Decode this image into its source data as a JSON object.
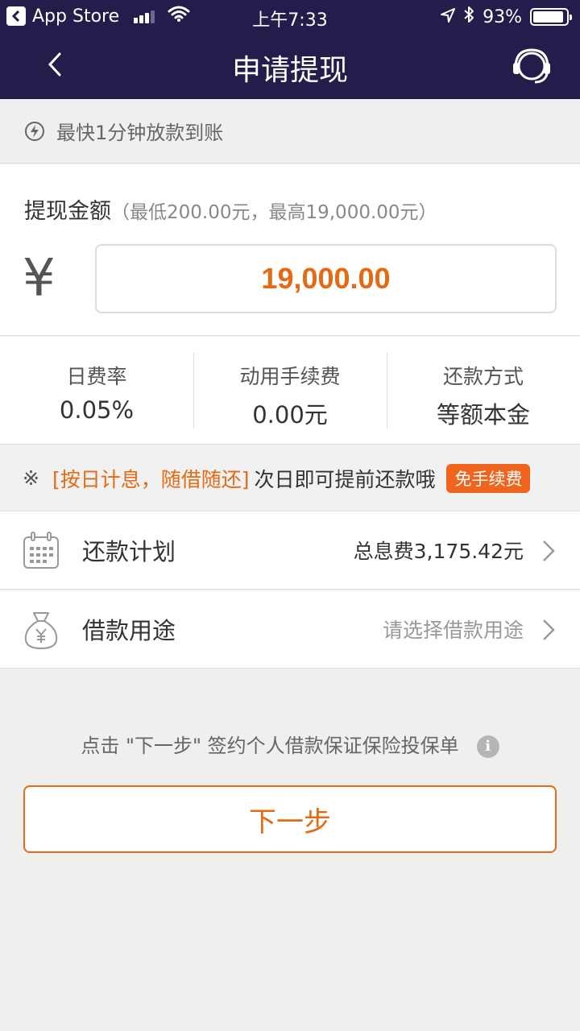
{
  "status_bar": {
    "back_app": "App Store",
    "time": "上午7:33",
    "battery": "93%",
    "battery_level": 0.93
  },
  "nav": {
    "title": "申请提现",
    "back_icon": "chevron-left-icon",
    "support_icon": "customer-service-headset-icon"
  },
  "notice": {
    "text": "最快1分钟放款到账",
    "icon": "lightning-icon"
  },
  "amount": {
    "title": "提现金额",
    "hint": "（最低200.00元，最高19,000.00元）",
    "currency_symbol": "¥",
    "value": "19,000.00"
  },
  "stats": [
    {
      "label": "日费率",
      "value": "0.05%"
    },
    {
      "label": "动用手续费",
      "value": "0.00元"
    },
    {
      "label": "还款方式",
      "value": "等额本金"
    }
  ],
  "promo": {
    "mark": "※",
    "highlight": "[按日计息，随借随还]",
    "text": "次日即可提前还款哦",
    "badge": "免手续费"
  },
  "rows": [
    {
      "label": "还款计划",
      "value": "总息费3,175.42元",
      "icon": "calendar-icon"
    },
    {
      "label": "借款用途",
      "value": "请选择借款用途",
      "icon": "money-bag-icon"
    }
  ],
  "insurance_note": "点击 \"下一步\" 签约个人借款保证保险投保单",
  "next_button": "下一步",
  "colors": {
    "header_bg": "#261c4c",
    "accent": "#e46a13",
    "badge": "#f0641e"
  }
}
